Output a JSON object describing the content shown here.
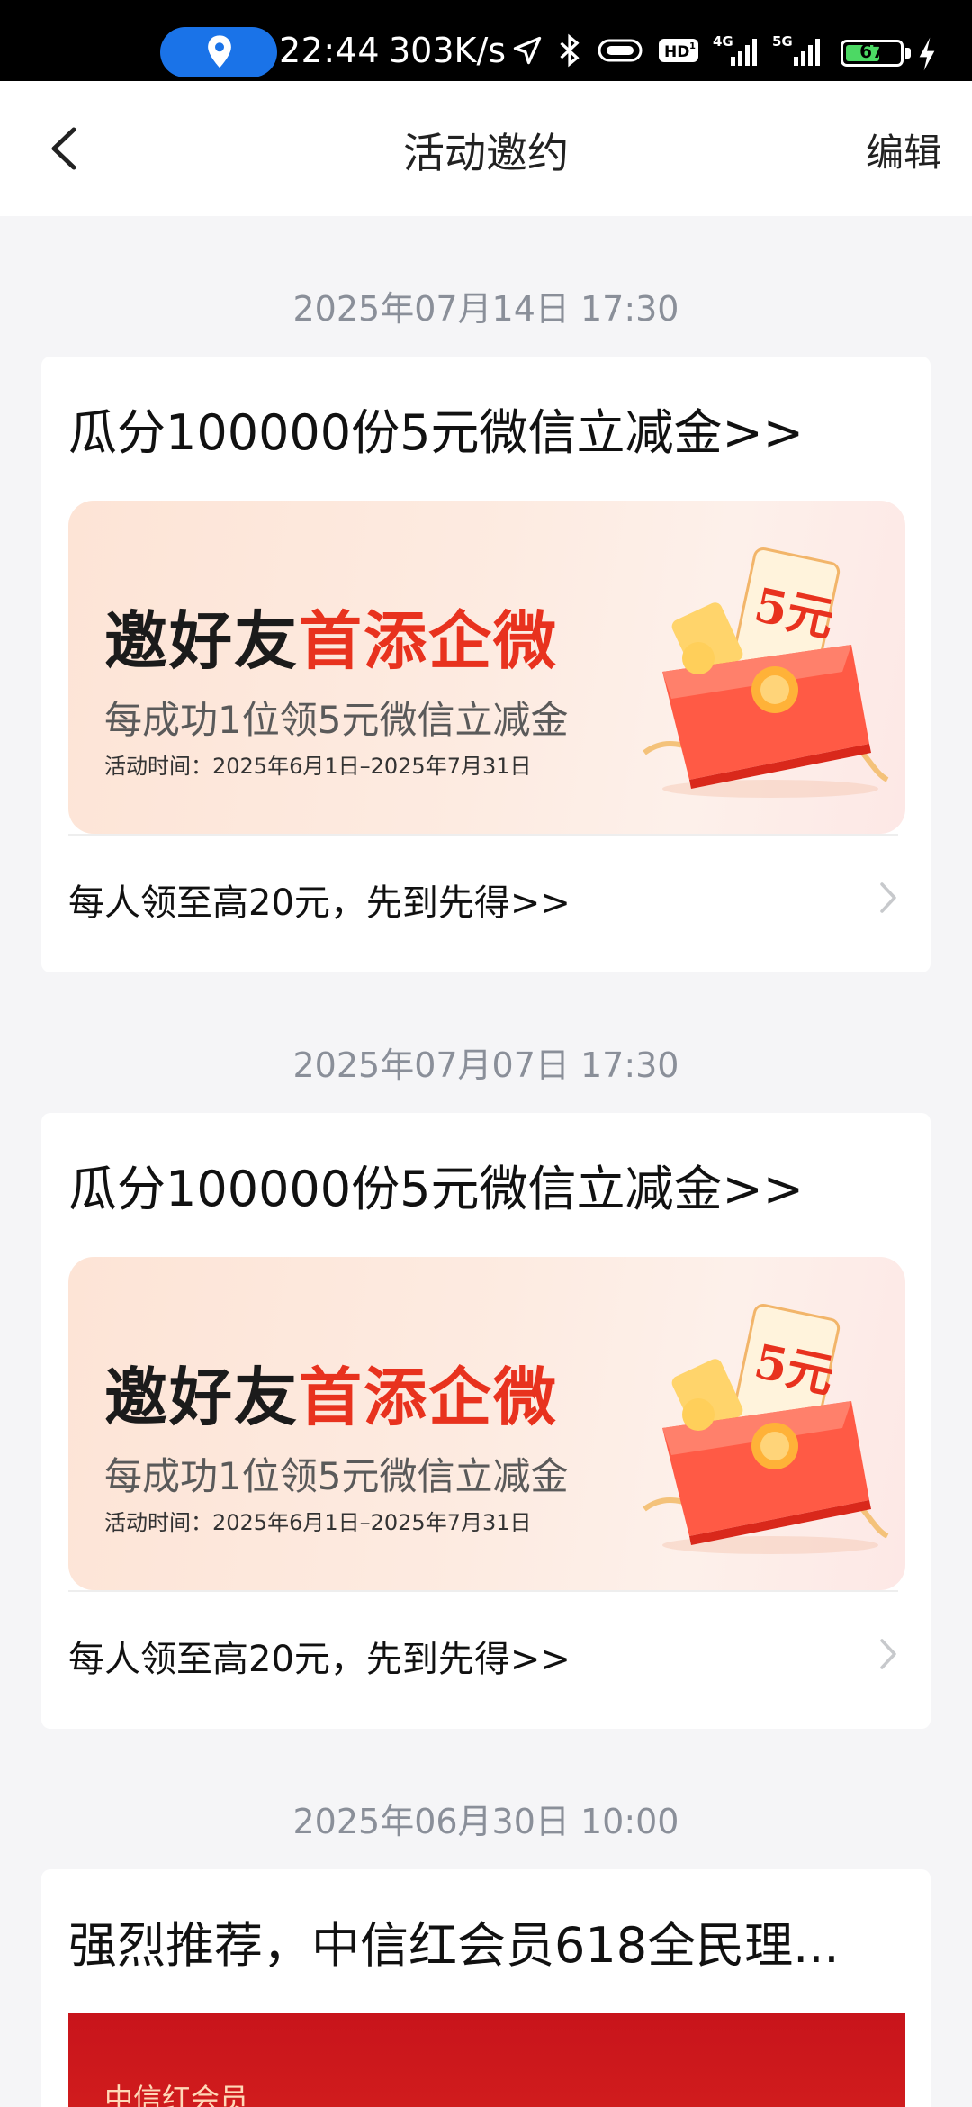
{
  "status_bar": {
    "time": "22:44",
    "speed": "303K/s",
    "battery": "67",
    "battery_level": 0.67
  },
  "header": {
    "title": "活动邀约",
    "edit_label": "编辑"
  },
  "feed": [
    {
      "date": "2025年07月14日 17:30",
      "title": "瓜分100000份5元微信立减金>>",
      "banner": {
        "headline_black": "邀好友",
        "headline_red": "首添企微",
        "subtitle": "每成功1位领5元微信立减金",
        "period": "活动时间：2025年6月1日–2025年7月31日",
        "badge": "5元"
      },
      "footer": "每人领至高20元，先到先得>>"
    },
    {
      "date": "2025年07月07日 17:30",
      "title": "瓜分100000份5元微信立减金>>",
      "banner": {
        "headline_black": "邀好友",
        "headline_red": "首添企微",
        "subtitle": "每成功1位领5元微信立减金",
        "period": "活动时间：2025年6月1日–2025年7月31日",
        "badge": "5元"
      },
      "footer": "每人领至高20元，先到先得>>"
    },
    {
      "date": "2025年06月30日 10:00",
      "title": "强烈推荐，中信红会员618全民理...",
      "banner_text": "中信红会员"
    }
  ],
  "colors": {
    "accent_red": "#e8321e",
    "date_gray": "#8a8f99",
    "status_blue": "#1a73e8",
    "battery_green": "#4cd964"
  },
  "icons": [
    "location-icon",
    "navigation-icon",
    "bluetooth-icon",
    "vibrate-icon",
    "hd-icon",
    "signal-4g-icon",
    "signal-5g-icon",
    "battery-icon",
    "charging-icon",
    "back-icon",
    "chevron-right-icon"
  ]
}
